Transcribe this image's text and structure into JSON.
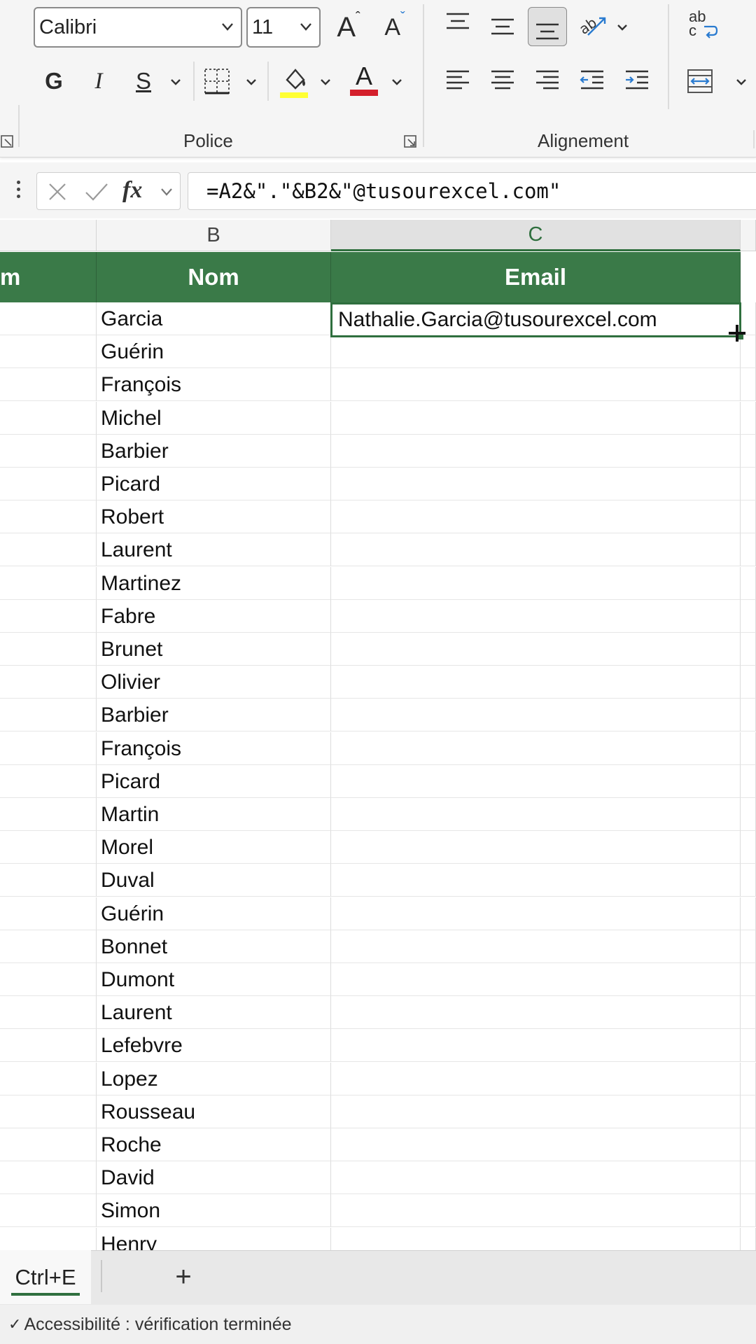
{
  "ribbon": {
    "font_name": "Calibri",
    "font_size": "11",
    "bold_label": "G",
    "italic_label": "I",
    "strike_label": "S",
    "font_color_label": "A",
    "grow_font_label": "A",
    "shrink_font_label": "A",
    "wrap_label": "ab\nc",
    "police_group": "Police",
    "alignement_group": "Alignement",
    "highlight_color": "#ffff33",
    "font_color": "#d41f2b"
  },
  "formula_bar": {
    "formula": "=A2&\".\"&B2&\"@tusourexcel.com\"",
    "fx_label": "fx"
  },
  "grid": {
    "columns": [
      "B",
      "C"
    ],
    "partial_header": "m",
    "header_b": "Nom",
    "header_c": "Email",
    "header_color": "#3a7a48",
    "active_cell_value": "Nathalie.Garcia@tusourexcel.com",
    "names": [
      "Garcia",
      "Guérin",
      "François",
      "Michel",
      "Barbier",
      "Picard",
      "Robert",
      "Laurent",
      "Martinez",
      "Fabre",
      "Brunet",
      "Olivier",
      "Barbier",
      "François",
      "Picard",
      "Martin",
      "Morel",
      "Duval",
      "Guérin",
      "Bonnet",
      "Dumont",
      "Laurent",
      "Lefebvre",
      "Lopez",
      "Rousseau",
      "Roche",
      "David",
      "Simon",
      "Henry"
    ]
  },
  "sheets": {
    "active_tab": "Ctrl+E",
    "add_label": "+"
  },
  "status_bar": {
    "accessibility": "Accessibilité : vérification terminée"
  }
}
